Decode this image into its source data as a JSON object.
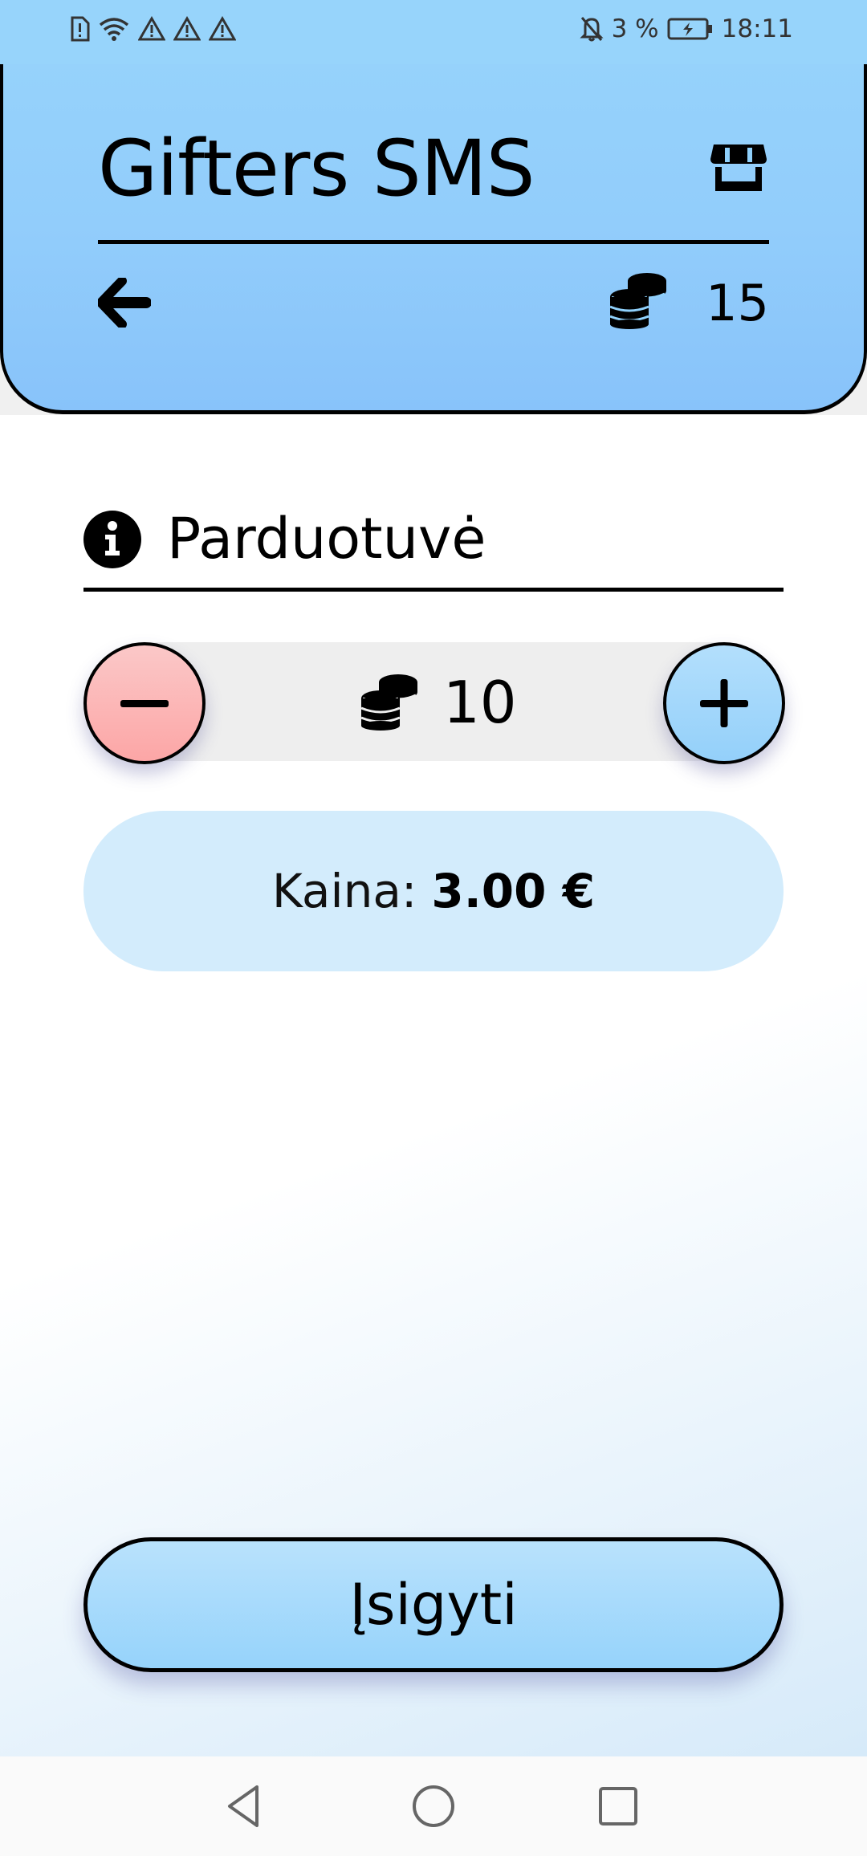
{
  "status_bar": {
    "icons_left": [
      "sim-alert-icon",
      "wifi-icon",
      "warning-icon",
      "warning-icon",
      "warning-icon"
    ],
    "icons_right": [
      "bell-off-icon",
      "battery-charging-icon"
    ],
    "battery": "3 %",
    "time": "18:11"
  },
  "header": {
    "title": "Gifters SMS",
    "balance": "15",
    "icons": [
      "shop-icon",
      "back-arrow-icon",
      "coins-icon"
    ],
    "background_color": "#97d4fb"
  },
  "section": {
    "title": "Parduotuvė",
    "icon": "info-icon"
  },
  "stepper": {
    "value": "10",
    "minus_color": "#fca6a6",
    "plus_color": "#94d0fa"
  },
  "price": {
    "label": "Kaina:",
    "value": "3.00 €"
  },
  "buy_button": {
    "label": "Įsigyti"
  },
  "nav_bar": {
    "buttons": [
      "nav-back-icon",
      "nav-home-icon",
      "nav-recent-icon"
    ]
  }
}
